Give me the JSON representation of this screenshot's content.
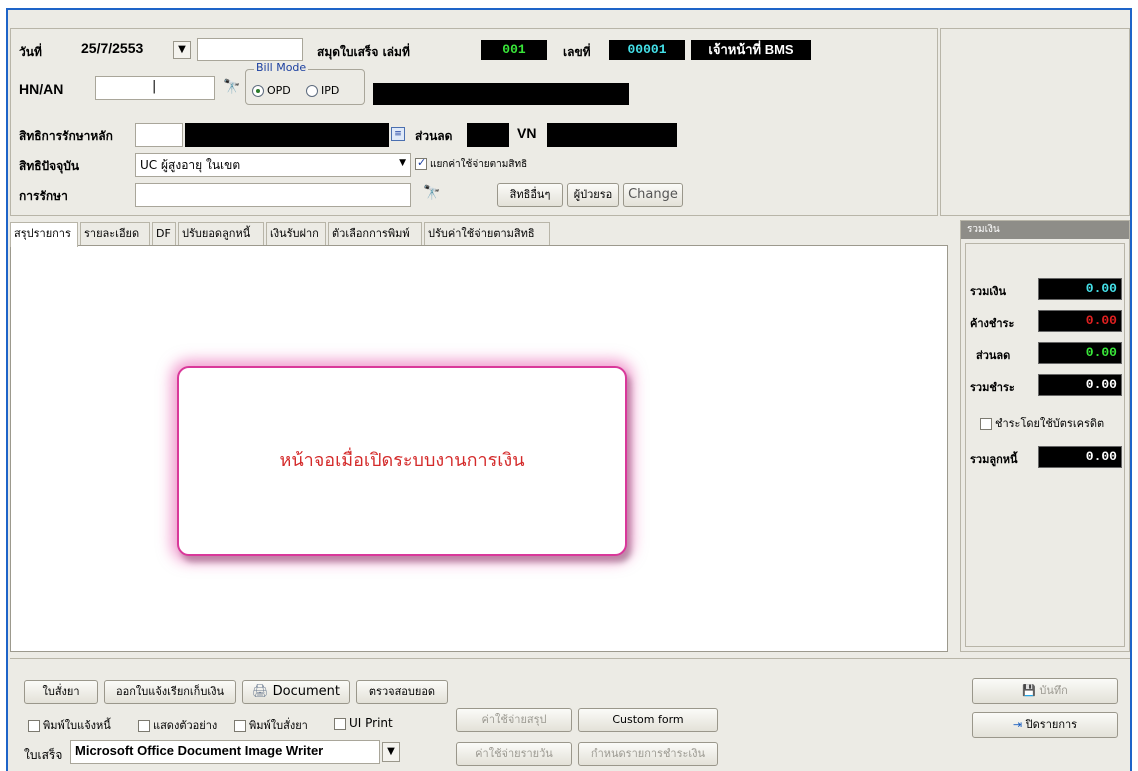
{
  "header": {
    "date_label": "วันที่",
    "date_value": "25/7/2553",
    "book_label": "สมุดใบเสร็จ  เล่มที่",
    "book_no": "001",
    "number_label": "เลขที่",
    "receipt_no": "00001",
    "officer": "เจ้าหน้าที่ BMS",
    "hn_label": "HN/AN",
    "hn_value": "|",
    "bill_mode_label": "Bill Mode",
    "bill_mode_opd": "OPD",
    "bill_mode_ipd": "IPD",
    "bill_mode_selected": "OPD",
    "main_right_label": "สิทธิการรักษาหลัก",
    "discount_label": "ส่วนลด",
    "vn_label": "VN",
    "current_right_label": "สิทธิปัจจุบัน",
    "current_right_value": "UC ผู้สูงอายุ ในเขต",
    "split_expense_label": "แยกค่าใช้จ่ายตามสิทธิ",
    "split_expense_checked": true,
    "treatment_label": "การรักษา",
    "treatment_value": "",
    "other_rights_button": "สิทธิอื่นๆ",
    "waiting_button": "ผู้ป่วยรอ",
    "change_button": "Change"
  },
  "tabs": [
    {
      "label": "สรุปรายการ",
      "active": true
    },
    {
      "label": "รายละเอียด",
      "active": false
    },
    {
      "label": "DF",
      "active": false
    },
    {
      "label": "ปรับยอดลูกหนี้",
      "active": false
    },
    {
      "label": "เงินรับฝาก",
      "active": false
    },
    {
      "label": "ตัวเลือกการพิมพ์",
      "active": false
    },
    {
      "label": "ปรับค่าใช้จ่ายตามสิทธิ",
      "active": false
    }
  ],
  "main": {
    "message": "หน้าจอเมื่อเปิดระบบงานการเงิน"
  },
  "summary": {
    "title": "รวมเงิน",
    "total_label": "รวมเงิน",
    "total_value": "0.00",
    "outstanding_label": "ค้างชำระ",
    "outstanding_value": "0.00",
    "discount_label": "ส่วนลด",
    "discount_value": "0.00",
    "paid_label": "รวมชำระ",
    "paid_value": "0.00",
    "credit_card_label": "ชำระโดยใช้บัตรเครดิต",
    "debtor_label": "รวมลูกหนี้",
    "debtor_value": "0.00"
  },
  "footer": {
    "prescription_button": "ใบสั่งยา",
    "invoice_button": "ออกใบแจ้งเรียกเก็บเงิน",
    "document_button": "Document",
    "check_total_button": "ตรวจสอบยอด",
    "print_invoice_label": "พิมพ์ใบแจ้งหนี้",
    "show_example_label": "แสดงตัวอย่าง",
    "print_prescription_label": "พิมพ์ใบสั่งยา",
    "ui_print_label": "UI Print",
    "receipt_label": "ใบเสร็จ",
    "printer_value": "Microsoft Office Document Image Writer",
    "expense_summary_button": "ค่าใช้จ่ายสรุป",
    "custom_form_button": "Custom form",
    "daily_expense_button": "ค่าใช้จ่ายรายวัน",
    "payment_schedule_button": "กำหนดรายการชำระเงิน",
    "save_button": "บันทึก",
    "close_button": "ปิดรายการ"
  },
  "colors": {
    "window_border": "#1e64c8",
    "led_green": "#39e639",
    "led_cyan": "#44e0e8",
    "outstanding_red": "#e02020",
    "message_red": "#d42a2a",
    "message_border": "#d9389a"
  }
}
